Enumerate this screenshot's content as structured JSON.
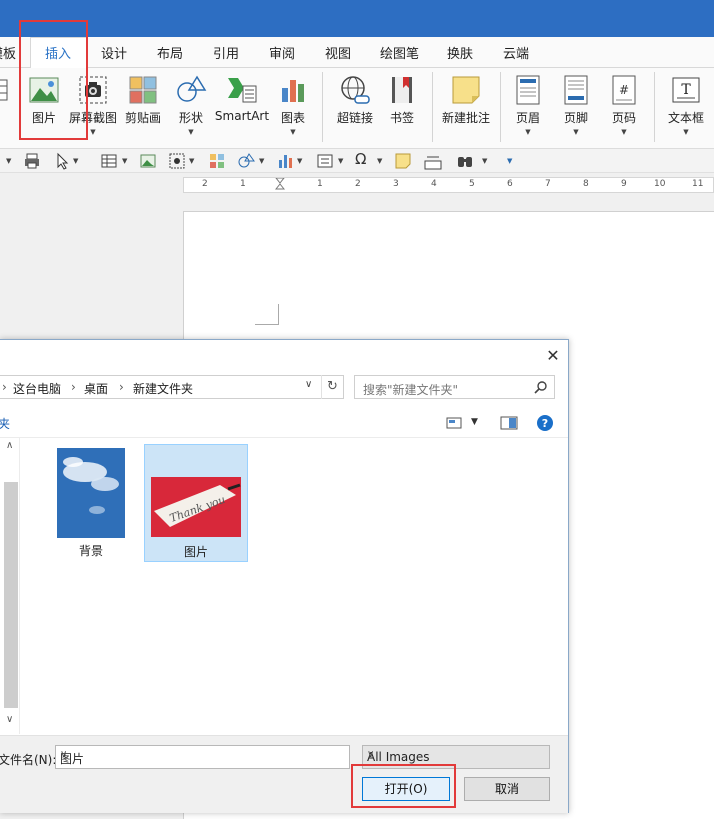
{
  "tabs": {
    "t0": "模板",
    "t1": "插入",
    "t2": "设计",
    "t3": "布局",
    "t4": "引用",
    "t5": "审阅",
    "t6": "视图",
    "t7": "绘图笔",
    "t8": "换肤",
    "t9": "云端"
  },
  "ribbon": {
    "picture": "图片",
    "screenshot": "屏幕截图",
    "clipart": "剪贴画",
    "shapes": "形状",
    "smartart": "SmartArt",
    "chart": "图表",
    "hyperlink": "超链接",
    "bookmark": "书签",
    "new_comment": "新建批注",
    "header": "页眉",
    "footer": "页脚",
    "page_number": "页码",
    "textbox": "文本框"
  },
  "ruler": {
    "n2": "2",
    "n1a": "1",
    "n1b": "1",
    "n2b": "2",
    "n3": "3",
    "n4": "4",
    "n5": "5",
    "n6": "6",
    "n7": "7",
    "n8": "8",
    "n9": "9",
    "n10": "10",
    "n11": "11"
  },
  "dialog": {
    "close": "✕",
    "path": {
      "pc": "这台电脑",
      "desktop": "桌面",
      "folder": "新建文件夹"
    },
    "search_placeholder": "搜索\"新建文件夹\"",
    "organize_partial": "夹",
    "files": {
      "f0": "背景",
      "f1": "图片"
    },
    "filename_label": "文件名(N):",
    "filename_value": "图片",
    "filetype": "All Images",
    "open_button": "打开(O)",
    "cancel_button": "取消"
  },
  "colors": {
    "title_blue": "#2d6ec2",
    "highlight_red": "#e23a3a",
    "selection": "#cce4f7"
  }
}
